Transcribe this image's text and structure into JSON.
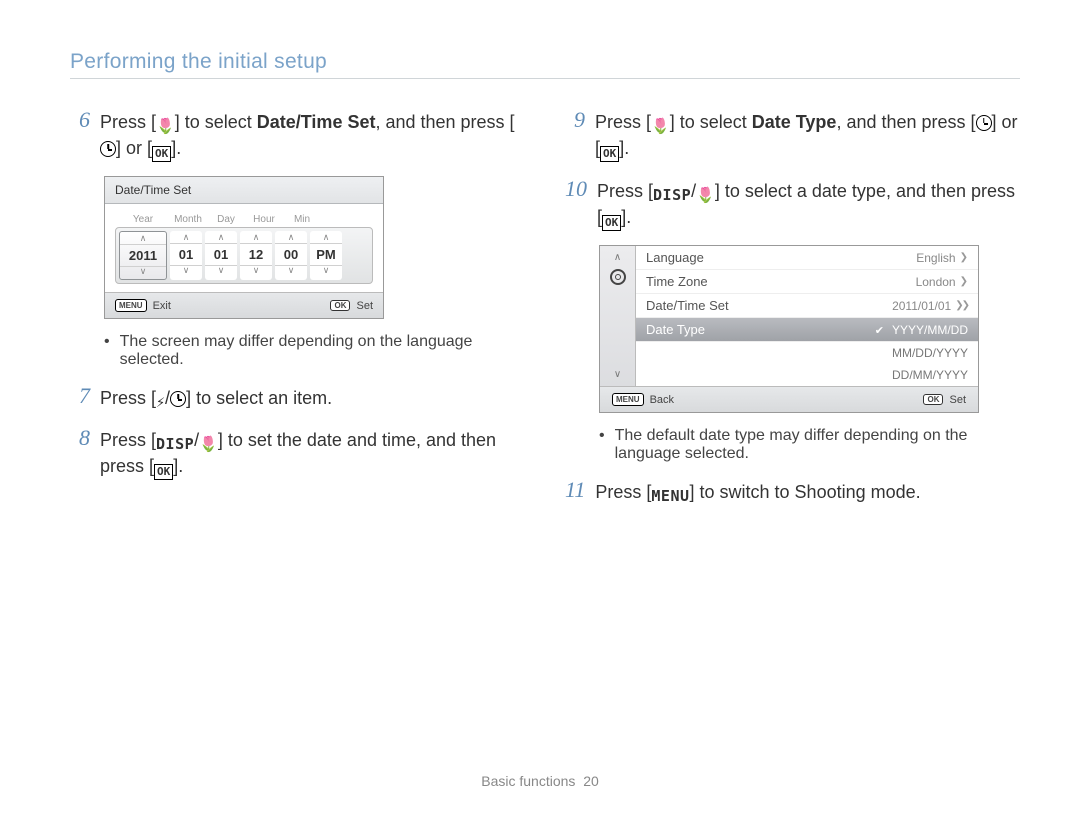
{
  "header": "Performing the initial setup",
  "steps": {
    "s6_num": "6",
    "s6_a": "Press [",
    "s6_b": "] to select ",
    "s6_bold": "Date/Time Set",
    "s6_c": ", and then press [",
    "s6_d": "] or [",
    "s6_e": "].",
    "s7_num": "7",
    "s7_a": "Press [",
    "s7_b": "/",
    "s7_c": "] to select an item.",
    "s8_num": "8",
    "s8_a": "Press [",
    "s8_disp": "DISP",
    "s8_b": "/",
    "s8_c": "] to set the date and time, and then press [",
    "s8_d": "].",
    "s9_num": "9",
    "s9_a": "Press [",
    "s9_b": "] to select ",
    "s9_bold": "Date Type",
    "s9_c": ", and then press [",
    "s9_d": "] or [",
    "s9_e": "].",
    "s10_num": "10",
    "s10_a": "Press [",
    "s10_disp": "DISP",
    "s10_b": "/",
    "s10_c": "] to select a date type, and then press [",
    "s10_d": "].",
    "s11_num": "11",
    "s11_a": "Press [",
    "s11_menu": "MENU",
    "s11_b": "] to switch to Shooting mode."
  },
  "notes": {
    "n1": "The screen may differ depending on the language selected.",
    "n2": "The default date type may differ depending on the language selected."
  },
  "datetime_screen": {
    "title": "Date/Time Set",
    "labels": {
      "year": "Year",
      "month": "Month",
      "day": "Day",
      "hour": "Hour",
      "min": "Min"
    },
    "values": {
      "year": "2011",
      "month": "01",
      "day": "01",
      "hour": "12",
      "min": "00",
      "ampm": "PM"
    },
    "footer": {
      "menu": "MENU",
      "exit": "Exit",
      "ok": "OK",
      "set": "Set"
    }
  },
  "menu_screen": {
    "rows": [
      {
        "label": "Language",
        "value": "English"
      },
      {
        "label": "Time Zone",
        "value": "London"
      },
      {
        "label": "Date/Time Set",
        "value": "2011/01/01"
      },
      {
        "label": "Date Type",
        "value": "YYYY/MM/DD"
      }
    ],
    "options": [
      "MM/DD/YYYY",
      "DD/MM/YYYY"
    ],
    "footer": {
      "menu": "MENU",
      "back": "Back",
      "ok": "OK",
      "set": "Set"
    }
  },
  "footer": {
    "section": "Basic functions",
    "page": "20"
  }
}
